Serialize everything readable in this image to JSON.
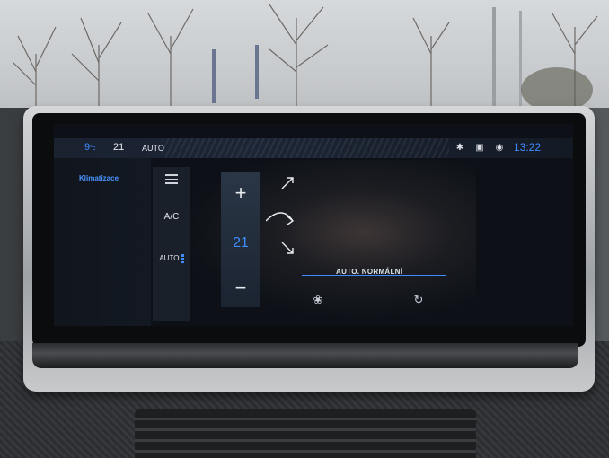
{
  "status_bar": {
    "left_temp": "9",
    "left_temp_unit": "°c",
    "right_temp": "21",
    "mode": "AUTO",
    "time": "13:22",
    "icons": [
      "bluetooth-icon",
      "car-icon",
      "signal-icon"
    ]
  },
  "side_menu": {
    "active_item": "Klimatizace"
  },
  "controls": {
    "menu_icon": "hamburger-menu-icon",
    "ac_label": "A/C",
    "auto_label": "AUTO"
  },
  "temperature": {
    "plus": "+",
    "value": "21",
    "minus": "−"
  },
  "airflow": {
    "arrows": [
      "up-right",
      "right",
      "down-right"
    ]
  },
  "status_text": "AUTO. NORMÁLNÍ",
  "bottom_icons": [
    "fan-icon",
    "recirculation-icon"
  ],
  "colors": {
    "accent_blue": "#3f8cff",
    "screen_bg": "#0d1117"
  }
}
